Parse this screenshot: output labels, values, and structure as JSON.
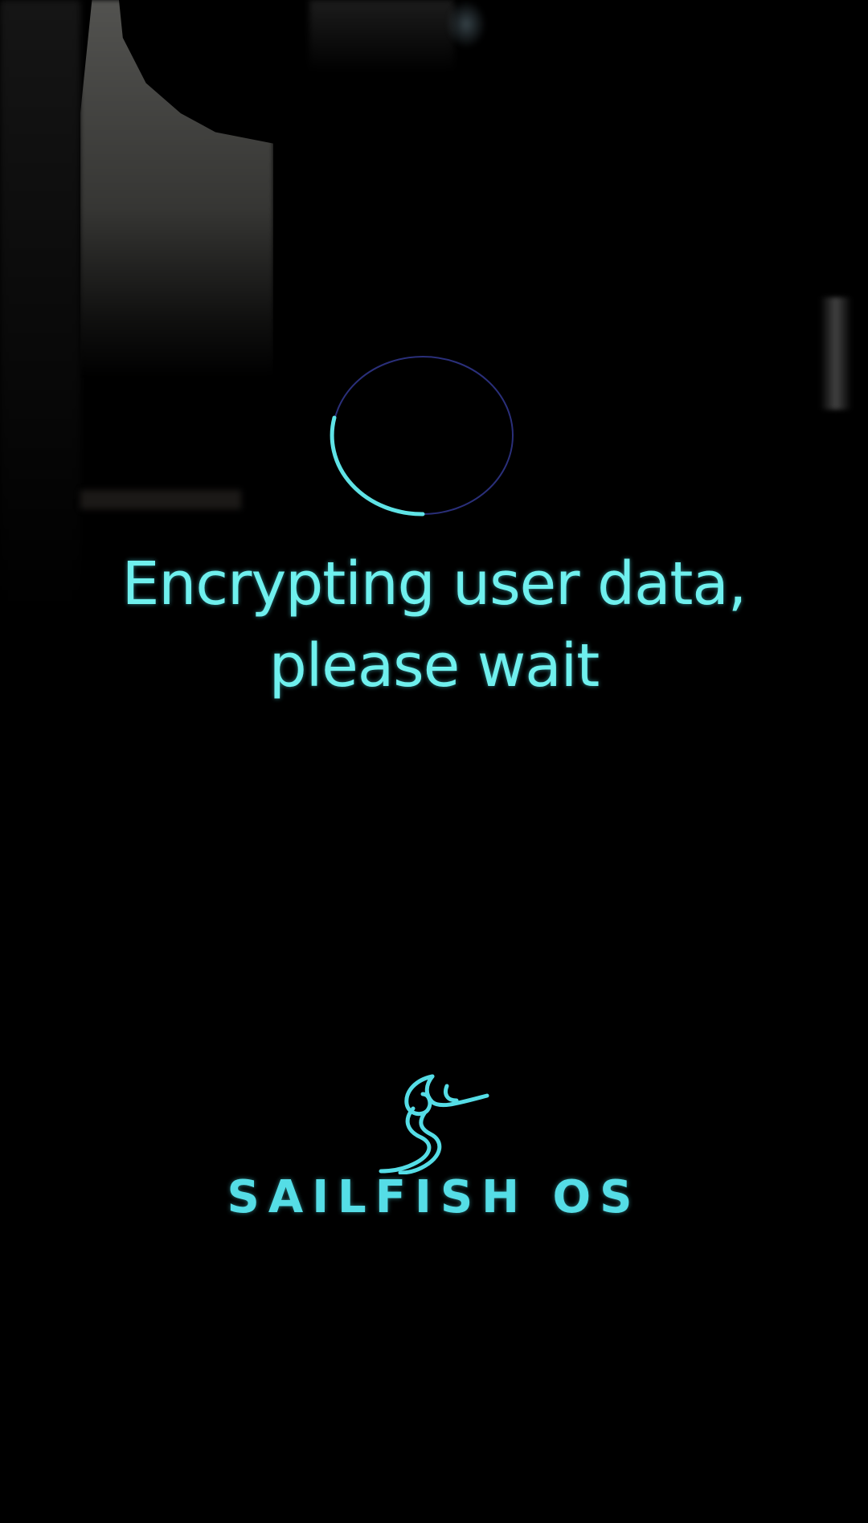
{
  "screen": {
    "background_color": "#000000",
    "accent_color": "#6ff0ee"
  },
  "busy_indicator": {
    "icon": "spinner-arc",
    "track_color": "#2a2f7a",
    "arc_color": "#5fe3e6"
  },
  "status": {
    "message_line1": "Encrypting user data,",
    "message_line2": "please wait"
  },
  "branding": {
    "logo_icon": "sailfish-logo",
    "name": "SAILFISH OS",
    "color": "#55dde6"
  }
}
